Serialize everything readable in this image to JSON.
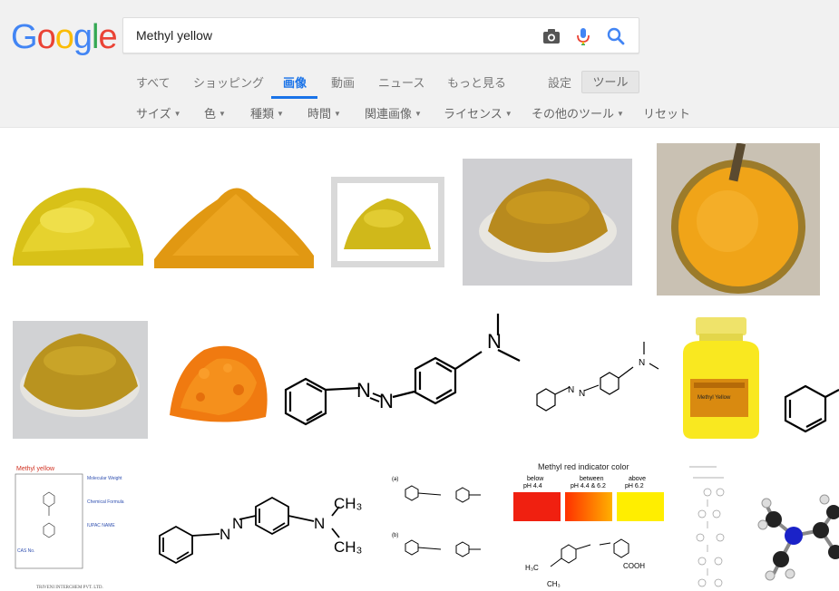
{
  "logo": {
    "letters": [
      "G",
      "o",
      "o",
      "g",
      "l",
      "e"
    ]
  },
  "search": {
    "value": "Methyl yellow"
  },
  "tabs": [
    {
      "label": "すべて"
    },
    {
      "label": "ショッピング"
    },
    {
      "label": "画像"
    },
    {
      "label": "動画"
    },
    {
      "label": "ニュース"
    },
    {
      "label": "もっと見る"
    },
    {
      "label": "設定"
    }
  ],
  "tools_label": "ツール",
  "filters": [
    {
      "label": "サイズ"
    },
    {
      "label": "色"
    },
    {
      "label": "種類"
    },
    {
      "label": "時間"
    },
    {
      "label": "関連画像"
    },
    {
      "label": "ライセンス"
    },
    {
      "label": "その他のツール"
    },
    {
      "label": "リセット"
    }
  ],
  "thumbs": {
    "card1": {
      "title": "Methyl yellow",
      "l1": "Molecular Weight",
      "l2": "Chemical Formula",
      "l3": "IUPAC NAME",
      "l4": "CAS No.",
      "footer": "TRIVENI INTERCHEM PVT. LTD."
    },
    "chart": {
      "title": "Methyl red indicator color",
      "below": "below",
      "below_ph": "pH 4.4",
      "between": "between",
      "between_ph": "pH 4.4 & 6.2",
      "above": "above",
      "above_ph": "pH 6.2",
      "cooh": "COOH",
      "h3c": "H₃C",
      "ch3": "CH₃"
    },
    "bottle": {
      "label": "Methyl Yellow"
    },
    "amine": {
      "ch3a": "CH₃",
      "ch3b": "CH₃",
      "n": "N",
      "n1": "N",
      "n2": "N"
    },
    "struct_ab": {
      "a": "(a)",
      "b": "(b)"
    }
  },
  "colors": {
    "blue": "#4285f4",
    "red": "#ea4335",
    "yellow": "#fbbc05",
    "green": "#34a853",
    "link": "#1a73e8"
  }
}
